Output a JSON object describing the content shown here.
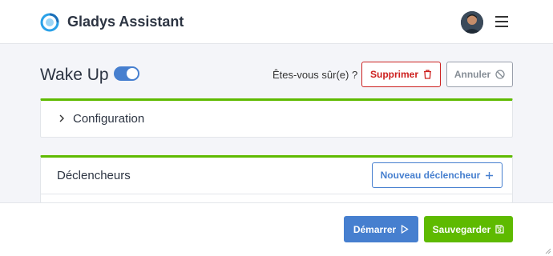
{
  "app": {
    "title": "Gladys Assistant"
  },
  "navbar": {
    "logo_icon": "gladys-logo-icon",
    "avatar_icon": "user-avatar",
    "menu_icon": "hamburger-menu-icon"
  },
  "scene": {
    "name": "Wake Up",
    "enabled": true,
    "confirm_text": "Êtes-vous sûr(e) ?",
    "delete_label": "Supprimer",
    "cancel_label": "Annuler"
  },
  "configuration": {
    "title": "Configuration"
  },
  "triggers": {
    "title": "Déclencheurs",
    "new_label": "Nouveau déclencheur"
  },
  "footer": {
    "start_label": "Démarrer",
    "save_label": "Sauvegarder"
  },
  "colors": {
    "primary": "#467fcf",
    "success": "#5eba00",
    "danger": "#cd201f",
    "muted": "#868e96"
  }
}
